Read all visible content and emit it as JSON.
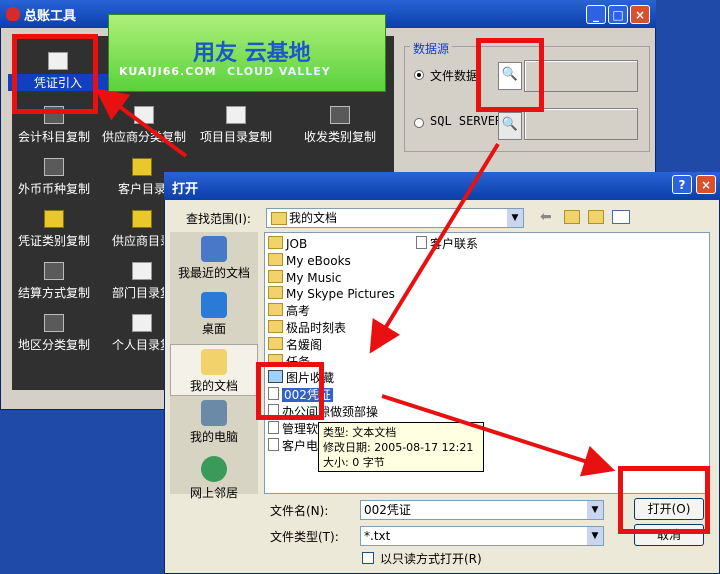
{
  "main_window": {
    "title": "总账工具",
    "buttons": {
      "minimize": "_",
      "maximize": "□",
      "close": "×"
    },
    "tools": [
      {
        "label": "凭证引入"
      },
      {
        "label": "会计科目复制"
      },
      {
        "label": "供应商分类复制"
      },
      {
        "label": "项目目录复制"
      },
      {
        "label": "收发类别复制"
      },
      {
        "label": "外币币种复制"
      },
      {
        "label": "客户目录"
      },
      {
        "label": "凭证类别复制"
      },
      {
        "label": "供应商目录"
      },
      {
        "label": "结算方式复制"
      },
      {
        "label": "部门目录复"
      },
      {
        "label": "地区分类复制"
      },
      {
        "label": "个人目录复"
      }
    ],
    "banner": {
      "logo": "用友 云基地",
      "site": "KUAIJI66.COM",
      "tagline": "CLOUD VALLEY"
    },
    "datasource": {
      "legend": "数据源",
      "file_option": "文件数据",
      "sql_option": "SQL SERVER",
      "browse_icon": "🔍"
    }
  },
  "dialog": {
    "title": "打开",
    "help_button": "?",
    "close_button": "×",
    "look_in_label": "查找范围(I):",
    "look_in_value": "我的文档",
    "places": [
      {
        "label": "我最近的文档"
      },
      {
        "label": "桌面"
      },
      {
        "label": "我的文档"
      },
      {
        "label": "我的电脑"
      },
      {
        "label": "网上邻居"
      }
    ],
    "files_col1": [
      {
        "name": "JOB",
        "kind": "folder"
      },
      {
        "name": "My eBooks",
        "kind": "folder"
      },
      {
        "name": "My Music",
        "kind": "folder"
      },
      {
        "name": "My Skype Pictures",
        "kind": "folder"
      },
      {
        "name": "高考",
        "kind": "folder"
      },
      {
        "name": "极品时刻表",
        "kind": "folder"
      },
      {
        "name": "名媛阁",
        "kind": "folder"
      },
      {
        "name": "任务",
        "kind": "folder"
      },
      {
        "name": "图片收藏",
        "kind": "picture"
      },
      {
        "name": "002凭证",
        "kind": "doc",
        "selected": true
      },
      {
        "name": "办公间隙做颈部操",
        "kind": "doc"
      },
      {
        "name": "管理软",
        "kind": "doc"
      },
      {
        "name": "客户电",
        "kind": "doc"
      }
    ],
    "files_col2": [
      {
        "name": "客户联系",
        "kind": "doc"
      }
    ],
    "tooltip": {
      "type": "类型: 文本文档",
      "modified": "修改日期: 2005-08-17 12:21",
      "size": "大小: 0 字节"
    },
    "filename_label": "文件名(N):",
    "filename_value": "002凭证",
    "filetype_label": "文件类型(T):",
    "filetype_value": "*.txt",
    "readonly_label": "以只读方式打开(R)",
    "open_button": "打开(O)",
    "cancel_button": "取消"
  },
  "colors": {
    "highlight": "#e81010",
    "titlebar": "#0b3fa8",
    "selection": "#3162c5"
  }
}
